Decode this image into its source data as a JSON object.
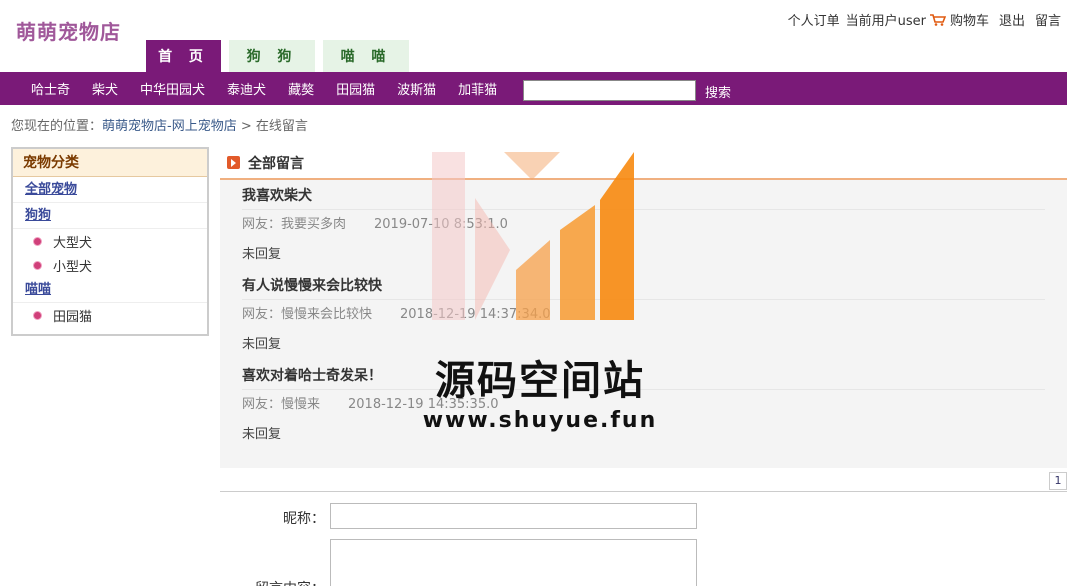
{
  "site": {
    "logo": "萌萌宠物店"
  },
  "toplinks": {
    "orders": "个人订单",
    "current_user": "当前用户user",
    "cart": "购物车",
    "logout": "退出",
    "message": "留言"
  },
  "tabs": [
    "首 页",
    "狗 狗",
    "喵 喵"
  ],
  "nav": {
    "items": [
      "哈士奇",
      "柴犬",
      "中华田园犬",
      "泰迪犬",
      "藏獒",
      "田园猫",
      "波斯猫",
      "加菲猫"
    ],
    "search_value": "",
    "search_button": "搜索"
  },
  "breadcrumb": {
    "prefix": "您现在的位置：",
    "site": "萌萌宠物店-网上宠物店",
    "sep": " > ",
    "current": "在线留言"
  },
  "sidebar": {
    "title": "宠物分类",
    "all": "全部宠物",
    "dogs": "狗狗",
    "dog_subs": [
      "大型犬",
      "小型犬"
    ],
    "cats": "喵喵",
    "cat_subs": [
      "田园猫"
    ]
  },
  "main": {
    "title": "全部留言",
    "messages": [
      {
        "title": "我喜欢柴犬",
        "author": "网友：我要买多肉",
        "time": "2019-07-10 8:53:1.0",
        "reply": "未回复"
      },
      {
        "title": "有人说慢慢来会比较快",
        "author": "网友：慢慢来会比较快",
        "time": "2018-12-19 14:37:34.0",
        "reply": "未回复"
      },
      {
        "title": "喜欢对着哈士奇发呆！",
        "author": "网友：慢慢来",
        "time": "2018-12-19 14:35:35.0",
        "reply": "未回复"
      }
    ],
    "page": "1"
  },
  "form": {
    "nick_label": "昵称：",
    "nick_value": "",
    "content_label": "留言内容："
  },
  "watermark": {
    "name": "源码空间站",
    "url": "www.shuyue.fun"
  }
}
